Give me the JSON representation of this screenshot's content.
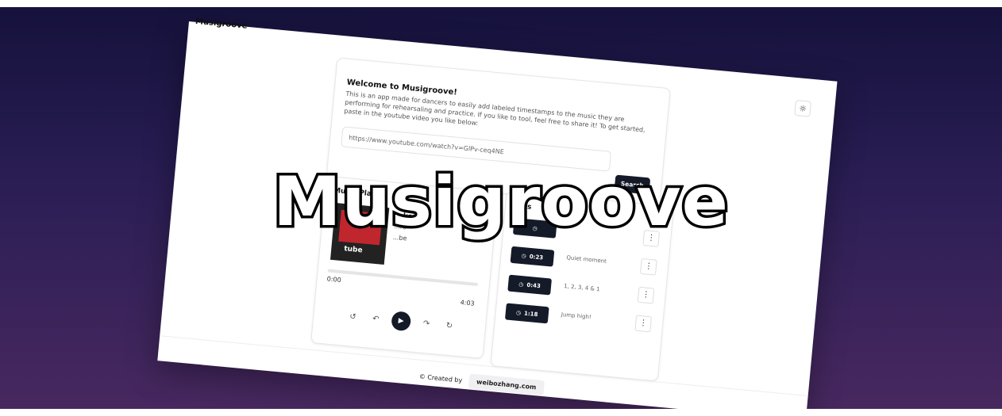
{
  "app": {
    "name": "Musigroove"
  },
  "hero": {
    "title": "Musigroove"
  },
  "welcome": {
    "title": "Welcome to Musigroove!",
    "description": "This is an app made for dancers to easily add labeled timestamps to the music they are performing for rehearsaling and practice. If you like to tool, feel free to share it! To get started, paste in the youtube video you like below:",
    "url_value": "https://www.youtube.com/watch?v=GlPv-ceq4NE",
    "search_label": "Search"
  },
  "player": {
    "title": "Music Player",
    "current_time": "0:00",
    "total_time": "4:03",
    "thumbnail_text": "tube",
    "song_title": "...ke",
    "song_artist": "...ro",
    "song_extra": "...be"
  },
  "timestamps": {
    "title": "...ps",
    "items": [
      {
        "time": "0:23",
        "label": "Quiet moment"
      },
      {
        "time": "0:43",
        "label": "1, 2, 3, 4 & 1"
      },
      {
        "time": "1:18",
        "label": "Jump high!"
      }
    ]
  },
  "footer": {
    "created_by": "© Created by",
    "link": "weibozhang.com"
  },
  "colors": {
    "background_top": "#15123c",
    "background_bottom": "#47285f",
    "button_dark": "#141a28"
  },
  "icons": {
    "theme": "sun-icon",
    "timer": "clock-icon",
    "menu": "kebab-icon"
  }
}
